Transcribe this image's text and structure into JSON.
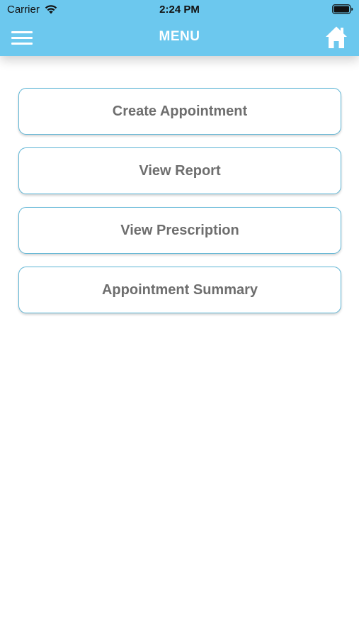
{
  "status_bar": {
    "carrier": "Carrier",
    "time": "2:24 PM"
  },
  "nav": {
    "title": "MENU",
    "background_color": "#6cc8ee",
    "left_icon": "menu-icon",
    "right_icon": "home-icon"
  },
  "menu": {
    "items": [
      {
        "label": "Create Appointment"
      },
      {
        "label": "View Report"
      },
      {
        "label": "View Prescription"
      },
      {
        "label": "Appointment Summary"
      }
    ],
    "border_color": "#5fb6d6",
    "text_color": "#6e6e6e"
  }
}
